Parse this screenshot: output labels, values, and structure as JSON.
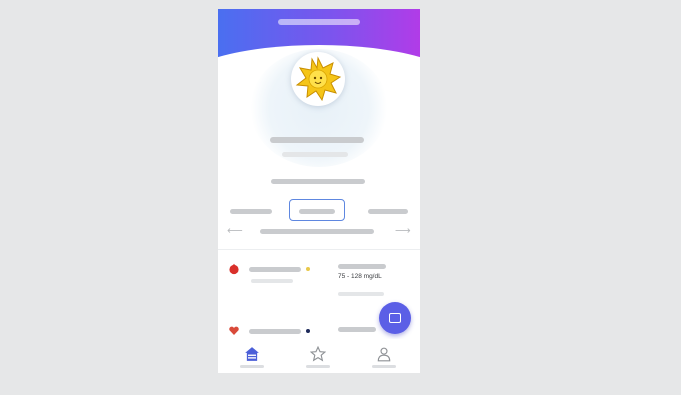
{
  "app": {
    "title_text": "",
    "accent_colors": {
      "header_start": "#4a6ff0",
      "header_end": "#b13ce8",
      "tab_outline": "#5e87e0",
      "fab": "#5b5fe6",
      "home_active": "#4b5fd8"
    }
  },
  "profile": {
    "avatar_icon": "sun-icon"
  },
  "tabs": {
    "selected_index": 1
  },
  "list": {
    "row1": {
      "icon": "red-drop-icon",
      "status_dot_color": "#e8c84a",
      "value": "75 - 128 mg/dL"
    },
    "row2": {
      "icon": "red-heart-icon",
      "status_dot_color": "#1e2a5a"
    }
  },
  "fab": {
    "icon": "toggle-icon"
  },
  "bottom_nav": {
    "items": [
      {
        "icon": "home-icon",
        "active": true
      },
      {
        "icon": "star-icon",
        "active": false
      },
      {
        "icon": "person-icon",
        "active": false
      }
    ]
  }
}
